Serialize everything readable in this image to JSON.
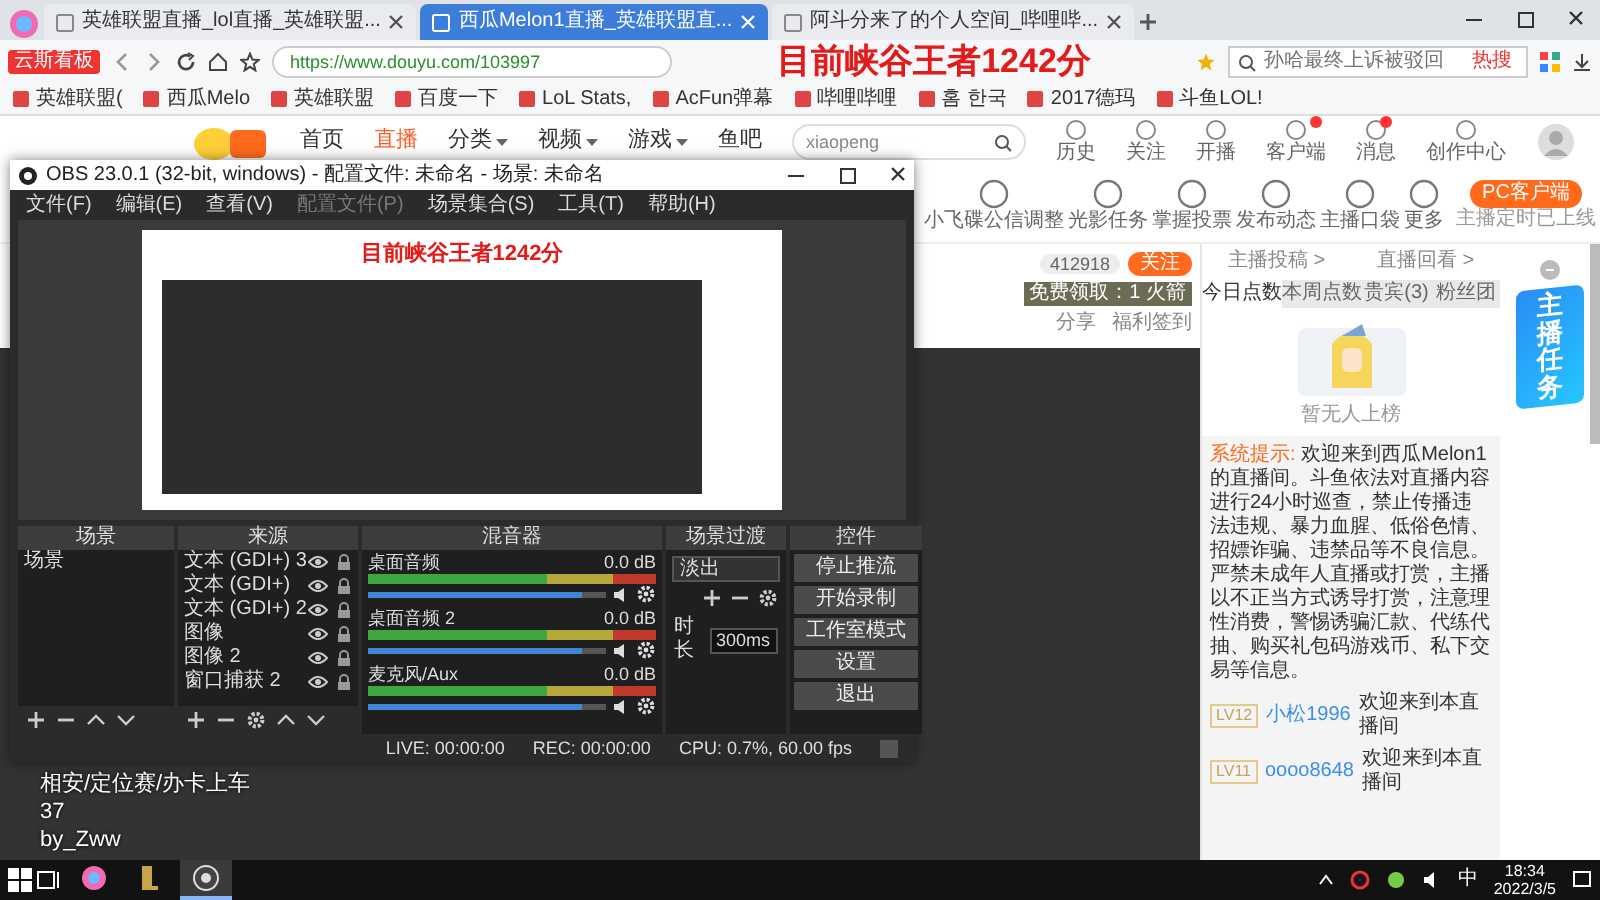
{
  "browser": {
    "tabs": [
      {
        "title": "英雄联盟直播_lol直播_英雄联盟...",
        "selected": false
      },
      {
        "title": "西瓜Melon1直播_英雄联盟直...",
        "selected": true
      },
      {
        "title": "阿斗分来了的个人空间_哔哩哔...",
        "selected": false
      }
    ],
    "badge": "云斯看板",
    "url": "https://www.douyu.com/103997",
    "search_hint": "孙哈最终上诉被驳回",
    "hot_label": "热搜",
    "bookmarks": [
      "英雄联盟(",
      "西瓜Melo",
      "英雄联盟",
      "百度一下",
      "LoL Stats,",
      "AcFun弹幕",
      "哔哩哔哩",
      "홈 한국",
      "2017德玛",
      "斗鱼LOL!"
    ]
  },
  "overlay_title": "目前峡谷王者1242分",
  "site": {
    "nav": [
      {
        "label": "首页",
        "selected": false,
        "dropdown": false
      },
      {
        "label": "直播",
        "selected": true,
        "dropdown": false
      },
      {
        "label": "分类",
        "selected": false,
        "dropdown": true
      },
      {
        "label": "视频",
        "selected": false,
        "dropdown": true
      },
      {
        "label": "游戏",
        "selected": false,
        "dropdown": true
      },
      {
        "label": "鱼吧",
        "selected": false,
        "dropdown": false
      }
    ],
    "search_value": "xiaopeng",
    "header_icons": [
      {
        "label": "历史",
        "badge": false
      },
      {
        "label": "关注",
        "badge": false
      },
      {
        "label": "开播",
        "badge": false
      },
      {
        "label": "客户端",
        "badge": true
      },
      {
        "label": "消息",
        "badge": true
      },
      {
        "label": "创作中心",
        "badge": false
      }
    ],
    "tools": [
      "小飞碟公信调整",
      "光影任务",
      "掌握投票",
      "发布动态",
      "主播口袋",
      "更多"
    ],
    "pc_button": "PC客户端",
    "pc_note": "主播定时已上线",
    "room": {
      "count": "412918",
      "follow": "关注",
      "gift": "免费领取：1 火箭",
      "share": "分享",
      "signin": "福利签到"
    },
    "chat": {
      "links": [
        "主播投稿 >",
        "直播回看 >"
      ],
      "tabs": [
        {
          "label": "今日点数",
          "selected": true
        },
        {
          "label": "本周点数",
          "selected": false
        },
        {
          "label": "贵宾(3)",
          "selected": false
        },
        {
          "label": "粉丝团",
          "selected": false
        }
      ],
      "empty": "暂无人上榜",
      "messages": [
        {
          "kind": "system",
          "label": "系统提示:",
          "text": "欢迎来到西瓜Melon1的直播间。斗鱼依法对直播内容进行24小时巡查，禁止传播违法违规、暴力血腥、低俗色情、招嫖诈骗、违禁品等不良信息。严禁未成年人直播或打赏，主播以不正当方式诱导打赏，注意理性消费，警惕诱骗汇款、代练代抽、购买礼包码游戏币、私下交易等信息。"
        },
        {
          "kind": "user",
          "rank": "LV12",
          "user": "小松1996",
          "text": "欢迎来到本直播间"
        },
        {
          "kind": "user",
          "rank": "LV11",
          "user": "oooo8648",
          "text": "欢迎来到本直播间"
        }
      ]
    },
    "task_widget": "主播任务"
  },
  "obs": {
    "title": "OBS 23.0.1 (32-bit, windows) - 配置文件: 未命名 - 场景: 未命名",
    "menu": [
      {
        "label": "文件(F)",
        "disabled": false
      },
      {
        "label": "编辑(E)",
        "disabled": false
      },
      {
        "label": "查看(V)",
        "disabled": false
      },
      {
        "label": "配置文件(P)",
        "disabled": true
      },
      {
        "label": "场景集合(S)",
        "disabled": false
      },
      {
        "label": "工具(T)",
        "disabled": false
      },
      {
        "label": "帮助(H)",
        "disabled": false
      }
    ],
    "preview_title": "目前峡谷王者1242分",
    "docks": [
      "场景",
      "来源",
      "混音器",
      "场景过渡",
      "控件"
    ],
    "scenes": [
      {
        "name": "场景",
        "selected": false
      }
    ],
    "sources": [
      "文本 (GDI+) 3",
      "文本 (GDI+)",
      "文本 (GDI+) 2",
      "图像",
      "图像 2",
      "窗口捕获 2"
    ],
    "mixer": [
      {
        "name": "桌面音频",
        "reading": "0.0 dB",
        "level": 0.9
      },
      {
        "name": "桌面音频 2",
        "reading": "0.0 dB",
        "level": 0.9
      },
      {
        "name": "麦克风/Aux",
        "reading": "0.0 dB",
        "level": 0.9
      }
    ],
    "transition": {
      "value": "淡出",
      "duration_label": "时长",
      "duration": "300ms"
    },
    "controls": [
      "停止推流",
      "开始录制",
      "工作室模式",
      "设置",
      "退出"
    ],
    "status": [
      "LIVE: 00:00:00",
      "REC: 00:00:00",
      "CPU: 0.7%, 60.00 fps"
    ]
  },
  "stream_overlay": [
    "相安/定位赛/办卡上车",
    "37",
    "by_Zww"
  ],
  "taskbar": {
    "apps": [
      {
        "kind": "browser",
        "active": false
      },
      {
        "kind": "game",
        "active": false
      },
      {
        "kind": "obs",
        "active": true
      }
    ],
    "ime": "中",
    "time": "18:34",
    "date": "2022/3/5"
  }
}
